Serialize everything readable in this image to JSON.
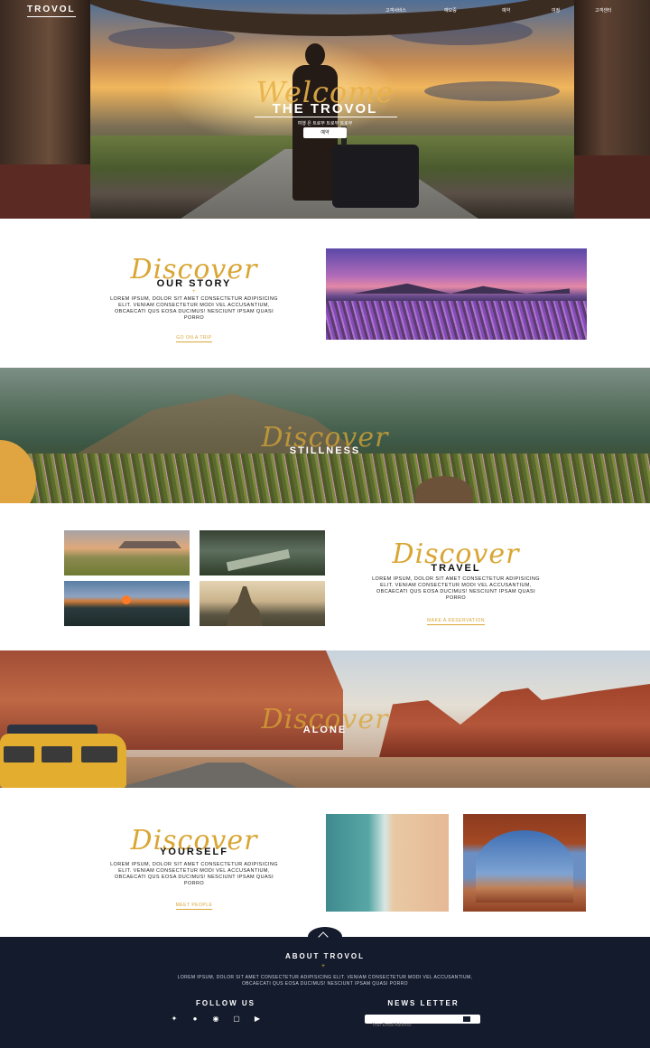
{
  "header": {
    "logo": "TROVOL",
    "nav": [
      "고객서비스",
      "예보증",
      "예약",
      "여정",
      "고객센터"
    ]
  },
  "hero": {
    "script": "Welcome",
    "title": "THE TROVOL",
    "subtitle": "여행 은 트로부 트로부 트로부",
    "button": "예약"
  },
  "story": {
    "script": "Discover",
    "title": "OUR STORY",
    "text": "LOREM IPSUM, DOLOR SIT AMET CONSECTETUR ADIPISICING ELIT. VENIAM CONSECTETUR MODI VEL ACCUSANTIUM, OBCAECATI QUS EOSA DUCIMUS! NESCIUNT IPSAM QUASI PORRO",
    "link": "GO ON A TRIP"
  },
  "stillness": {
    "script": "Discover",
    "title": "STILLNESS"
  },
  "travel": {
    "script": "Discover",
    "title": "TRAVEL",
    "text": "LOREM IPSUM, DOLOR SIT AMET CONSECTETUR ADIPISICING ELIT. VENIAM CONSECTETUR MODI VEL ACCUSANTIUM, OBCAECATI QUS EOSA DUCIMUS! NESCIUNT IPSAM QUASI PORRO",
    "link": "MAKE A RESERVATION"
  },
  "alone": {
    "script": "Discover",
    "title": "ALONE"
  },
  "yourself": {
    "script": "Discover",
    "title": "YOURSELF",
    "text": "LOREM IPSUM, DOLOR SIT AMET CONSECTETUR ADIPISICING ELIT. VENIAM CONSECTETUR MODI VEL ACCUSANTIUM, OBCAECATI QUS EOSA DUCIMUS! NESCIUNT IPSAM QUASI PORRO",
    "link": "MEET PEOPLE"
  },
  "footer": {
    "about_title": "ABOUT TROVOL",
    "about_text": "LOREM IPSUM, DOLOR SIT AMET CONSECTETUR ADIPISICING ELIT. VENIAM CONSECTETUR MODI VEL ACCUSANTIUM, OBCAECATI QUS EOSA DUCIMUS! NESCIUNT IPSAM QUASI PORRO",
    "follow_title": "FOLLOW US",
    "newsletter_title": "NEWS LETTER",
    "email_placeholder": "Your Email Address",
    "social_icons": [
      "twitter-icon",
      "facebook-icon",
      "pinterest-icon",
      "instagram-icon",
      "youtube-icon"
    ]
  }
}
